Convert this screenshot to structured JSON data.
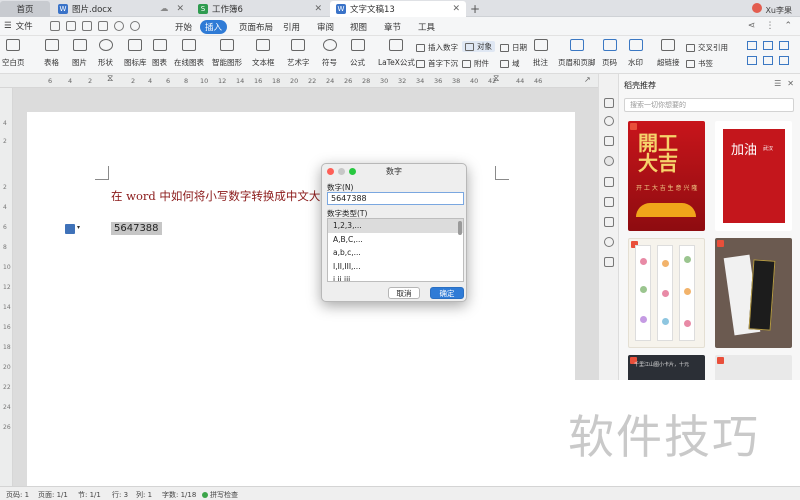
{
  "tabs": {
    "home": "首页",
    "doc1": "图片.docx",
    "doc2": "工作簿6",
    "doc3": "文字文稿13"
  },
  "user": {
    "name": "Xu李果"
  },
  "menu": {
    "file": "文件",
    "items": [
      "开始",
      "插入",
      "页面布局",
      "引用",
      "审阅",
      "视图",
      "章节",
      "工具"
    ]
  },
  "ribbon": {
    "large": [
      "空白页",
      "表格",
      "图片",
      "形状",
      "图标库",
      "图表",
      "在线图表",
      "智能图形",
      "文本框",
      "艺术字",
      "符号",
      "公式",
      "LaTeX公式",
      "批注",
      "页眉和页脚",
      "页码",
      "水印",
      "超链接"
    ],
    "small": [
      "插入数字",
      "对象",
      "日期",
      "首字下沉",
      "附件",
      "域",
      "交叉引用",
      "书签"
    ]
  },
  "ruler": {
    "h": [
      "6",
      "4",
      "2",
      "2",
      "4",
      "6",
      "8",
      "10",
      "12",
      "14",
      "16",
      "18",
      "20",
      "22",
      "24",
      "26",
      "28",
      "30",
      "32",
      "34",
      "36",
      "38",
      "40",
      "42",
      "44",
      "46"
    ],
    "v": [
      "4",
      "2",
      "2",
      "4",
      "6",
      "8",
      "10",
      "12",
      "14",
      "16",
      "18",
      "20",
      "22",
      "24",
      "26"
    ]
  },
  "document": {
    "heading": "在 word 中如何将小写数字转换成中文大写",
    "number": "5647388"
  },
  "dialog": {
    "title": "数字",
    "number_label": "数字(N)",
    "number_value": "5647388",
    "type_label": "数字类型(T)",
    "types": [
      "1,2,3,...",
      "A,B,C,...",
      "a,b,c,...",
      "I,II,III,...",
      "i,ii,iii,..."
    ],
    "cancel": "取消",
    "ok": "确定"
  },
  "panel": {
    "title": "稻壳推荐",
    "search_placeholder": "搜索一切你想要的",
    "card1_big": "開工\n大吉",
    "card1_sub": "开 工 大 吉   生 意 兴 隆",
    "card2_title": "加油",
    "card2_sub": "武汉",
    "card5_text": "千里江山图小卡片，十元"
  },
  "watermark": "软件技巧",
  "status": {
    "page": "页码: 1",
    "pages": "页面: 1/1",
    "section": "节: 1/1",
    "row": "行: 3",
    "col": "列: 1",
    "words": "字数: 1/18",
    "spell": "拼写检查"
  },
  "colors": {
    "accent": "#2f7bd6",
    "heading": "#8b1a1a"
  }
}
